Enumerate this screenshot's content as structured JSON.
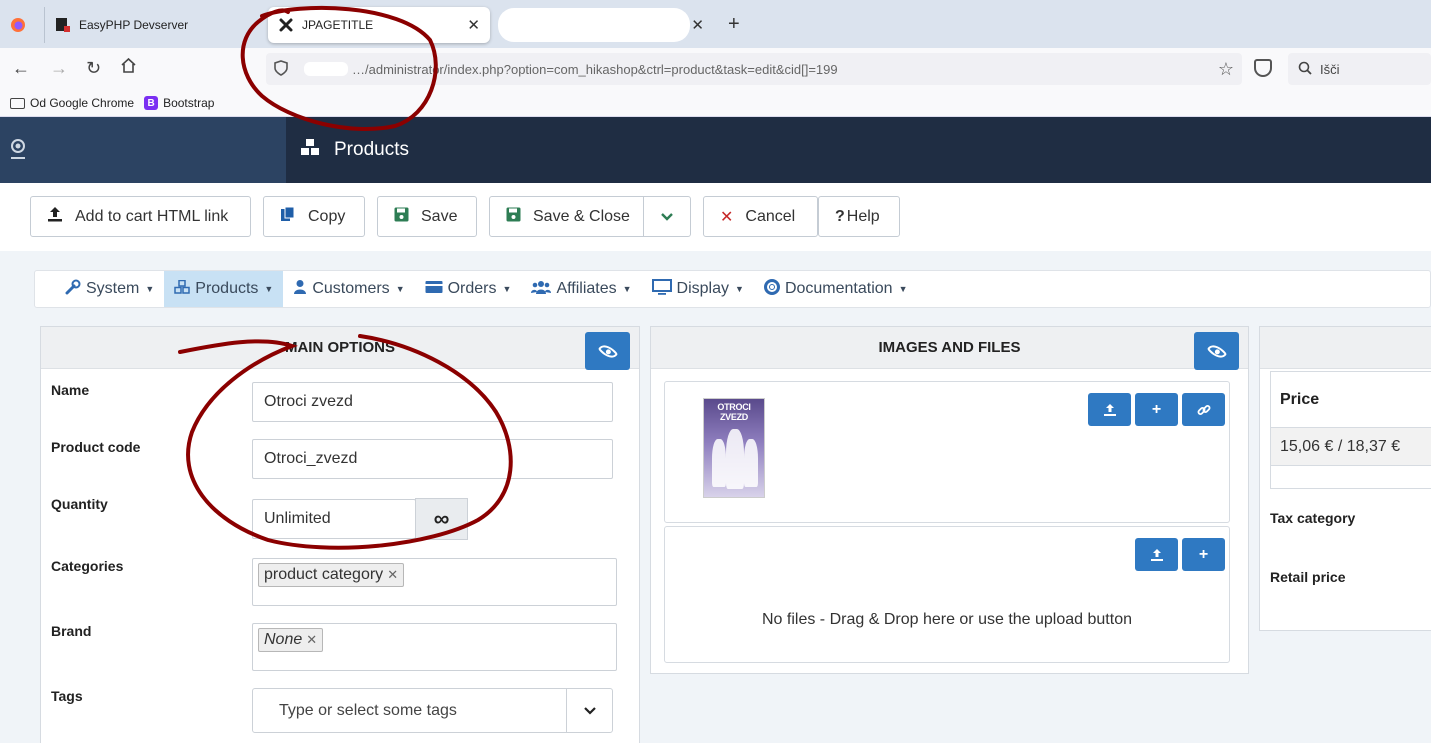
{
  "browser": {
    "tabs": [
      {
        "label": "EasyPHP Devserver"
      },
      {
        "label": "JPAGETITLE"
      },
      {
        "label": ""
      }
    ],
    "url": "…/administrator/index.php?option=com_hikashop&ctrl=product&task=edit&cid[]=199",
    "search_placeholder": "Išči",
    "bookmarks": [
      "Od Google Chrome",
      "Bootstrap"
    ]
  },
  "header": {
    "title": "Products"
  },
  "toolbar": {
    "add_to_cart": "Add to cart HTML link",
    "copy": "Copy",
    "save": "Save",
    "save_close": "Save & Close",
    "cancel": "Cancel",
    "help": "Help"
  },
  "menu": {
    "items": [
      "System",
      "Products",
      "Customers",
      "Orders",
      "Affiliates",
      "Display",
      "Documentation"
    ],
    "active": "Products"
  },
  "main_options": {
    "title": "MAIN OPTIONS",
    "name_label": "Name",
    "name_value": "Otroci zvezd",
    "code_label": "Product code",
    "code_value": "Otroci_zvezd",
    "quantity_label": "Quantity",
    "quantity_value": "Unlimited",
    "categories_label": "Categories",
    "category_chip": "product category",
    "brand_label": "Brand",
    "brand_chip": "None",
    "tags_label": "Tags",
    "tags_placeholder": "Type or select some tags"
  },
  "images_files": {
    "title": "IMAGES AND FILES",
    "book_title": "OTROCI ZVEZD",
    "no_files": "No files - Drag & Drop here or use the upload button"
  },
  "price_panel": {
    "price_header": "Price",
    "price_value": "15,06 € / 18,37 €",
    "tax_category_label": "Tax category",
    "retail_price_label": "Retail price"
  },
  "colors": {
    "header_bg": "#1f2d43",
    "sidebar_bg": "#2c4362",
    "accent_blue": "#2f79c2",
    "annotation_red": "#8b0000"
  }
}
